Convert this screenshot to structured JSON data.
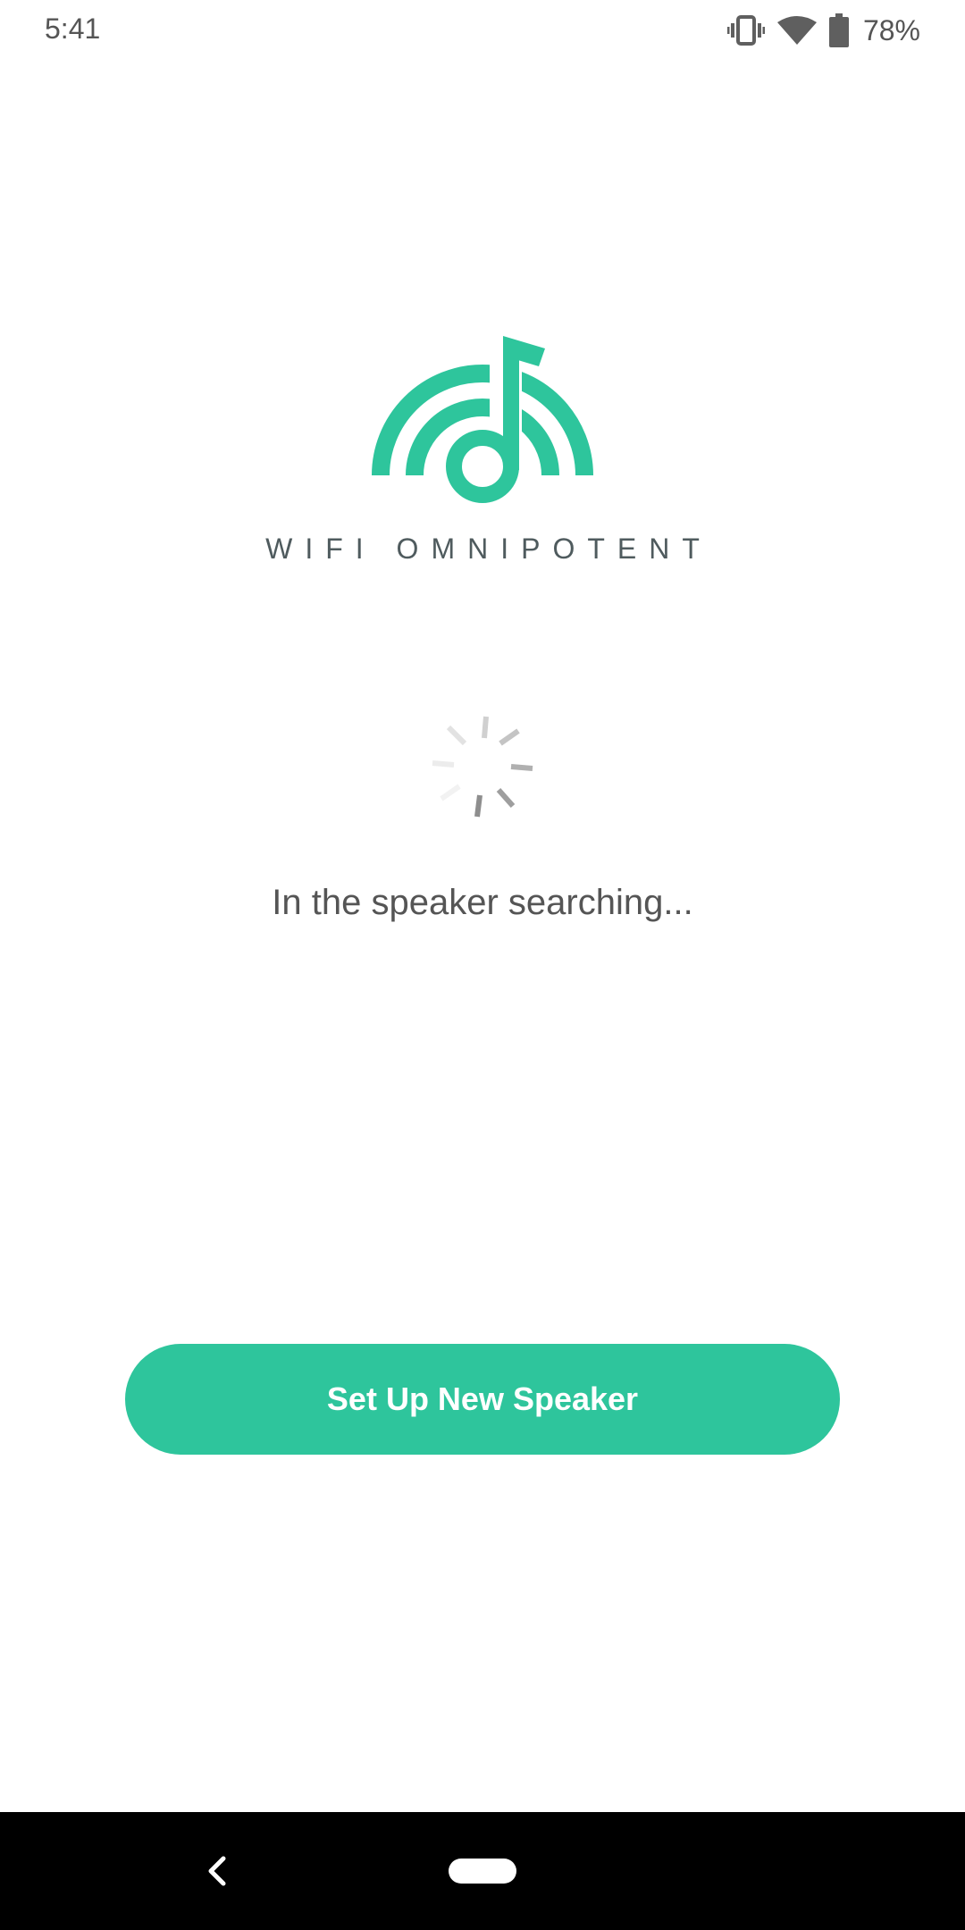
{
  "status_bar": {
    "time": "5:41",
    "battery_percent": "78%",
    "icons": [
      "vibrate-icon",
      "wifi-icon",
      "battery-icon"
    ]
  },
  "brand": {
    "name": "WIFI OMNIPOTENT",
    "accent_color": "#2ec59c"
  },
  "main": {
    "status_message": "In the speaker searching...",
    "setup_button_label": "Set Up New Speaker"
  },
  "nav_bar": {
    "icons": [
      "back-icon",
      "home-pill-icon"
    ]
  }
}
